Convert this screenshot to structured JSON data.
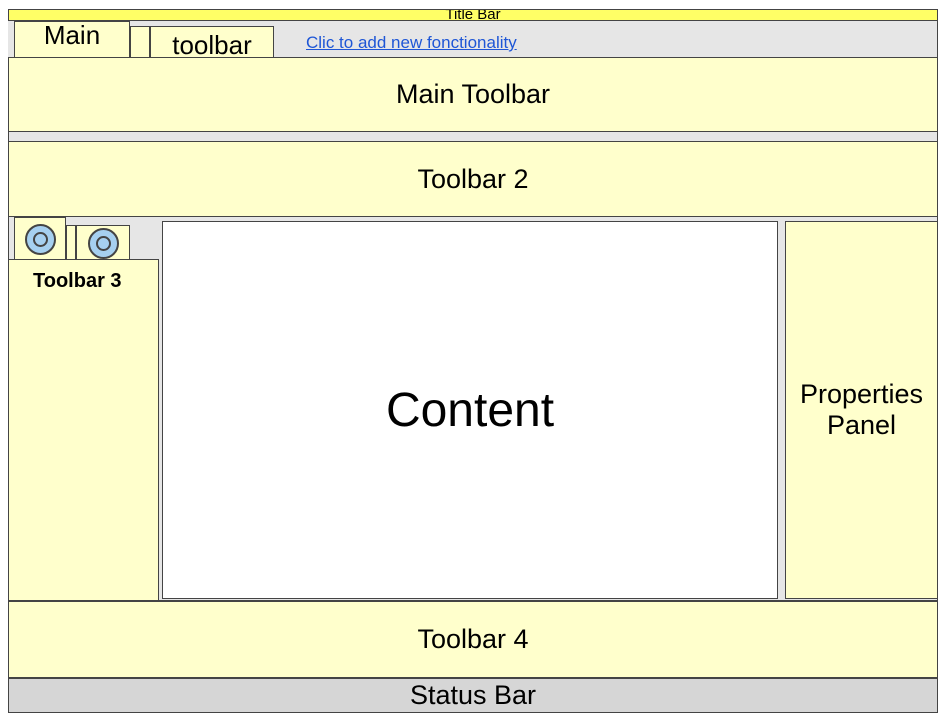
{
  "title_bar": {
    "label": "Title Bar"
  },
  "tabs": [
    {
      "label": "Main"
    },
    {
      "label": "toolbar"
    }
  ],
  "add_link": {
    "label": "Clic to add new fonctionality"
  },
  "main_toolbar": {
    "label": "Main Toolbar"
  },
  "toolbar2": {
    "label": "Toolbar 2"
  },
  "toolbar3": {
    "label": "Toolbar 3",
    "tab_icons": [
      "circle-icon",
      "circle-icon"
    ]
  },
  "content": {
    "label": "Content"
  },
  "properties_panel": {
    "line1": "Properties",
    "line2": "Panel"
  },
  "toolbar4": {
    "label": "Toolbar 4"
  },
  "status_bar": {
    "label": "Status Bar"
  },
  "colors": {
    "title_bar": "#ffff66",
    "panel": "#ffffcc",
    "background": "#e6e6e6",
    "status_bar": "#d6d6d6",
    "icon_fill": "#a6d0f0",
    "link": "#1e56d6"
  }
}
